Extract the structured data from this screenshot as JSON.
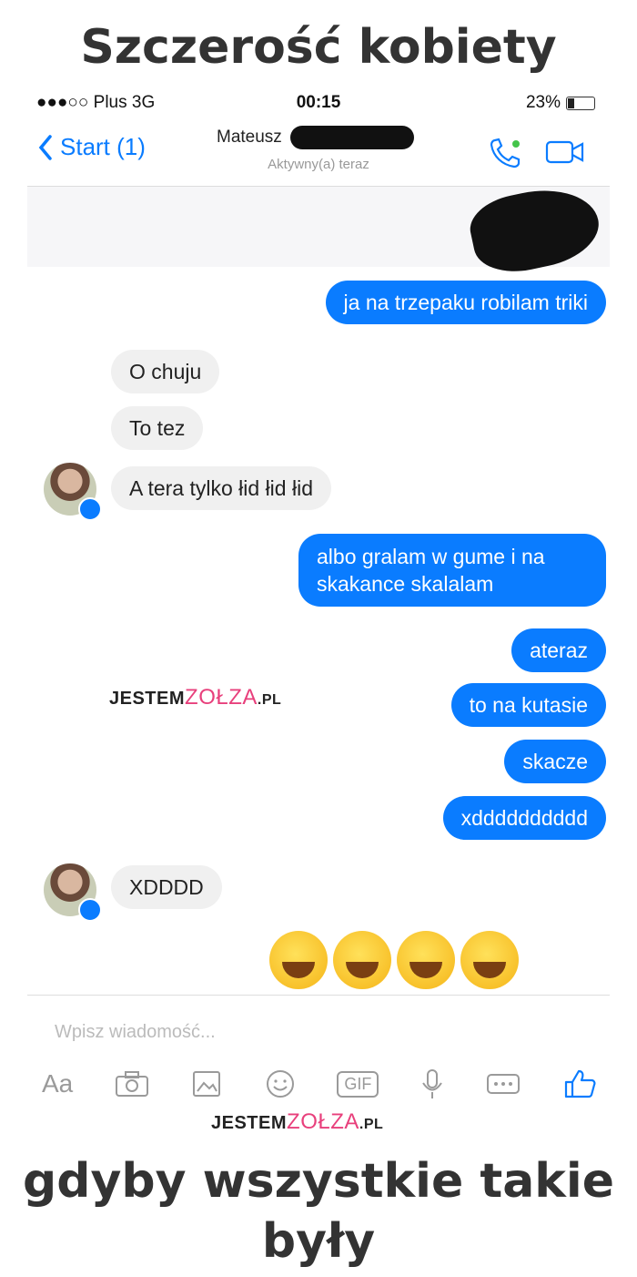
{
  "meme": {
    "top_caption": "Szczerość kobiety",
    "bottom_caption_line1": "gdyby wszystkie takie",
    "bottom_caption_line2": "były"
  },
  "status_bar": {
    "carrier": "●●●○○ Plus  3G",
    "time": "00:15",
    "battery": "23%"
  },
  "header": {
    "back_label": "Start (1)",
    "contact_name": "Mateusz",
    "status": "Aktywny(a) teraz"
  },
  "messages": {
    "m1": "ja na trzepaku robilam triki",
    "m2": "O chuju",
    "m3": "To tez",
    "m4": "A tera tylko łid łid łid",
    "m5": "albo gralam w gume i na skakance skalalam",
    "m6": "ateraz",
    "m7": "to na kutasie",
    "m8": "skacze",
    "m9": "xdddddddddd",
    "m10": "XDDDD"
  },
  "watermark": {
    "prefix": "JESTEM",
    "brand": "ZOŁZA",
    "suffix": ".PL"
  },
  "composer": {
    "placeholder": "Wpisz wiadomość...",
    "tools": [
      "Aa",
      "camera-icon",
      "gallery-icon",
      "emoji-icon",
      "GIF",
      "microphone-icon",
      "more-icon",
      "like-icon"
    ]
  },
  "colors": {
    "accent": "#0a7cff",
    "incoming_bubble": "#f0f0f0",
    "watermark_accent": "#e8407c"
  }
}
